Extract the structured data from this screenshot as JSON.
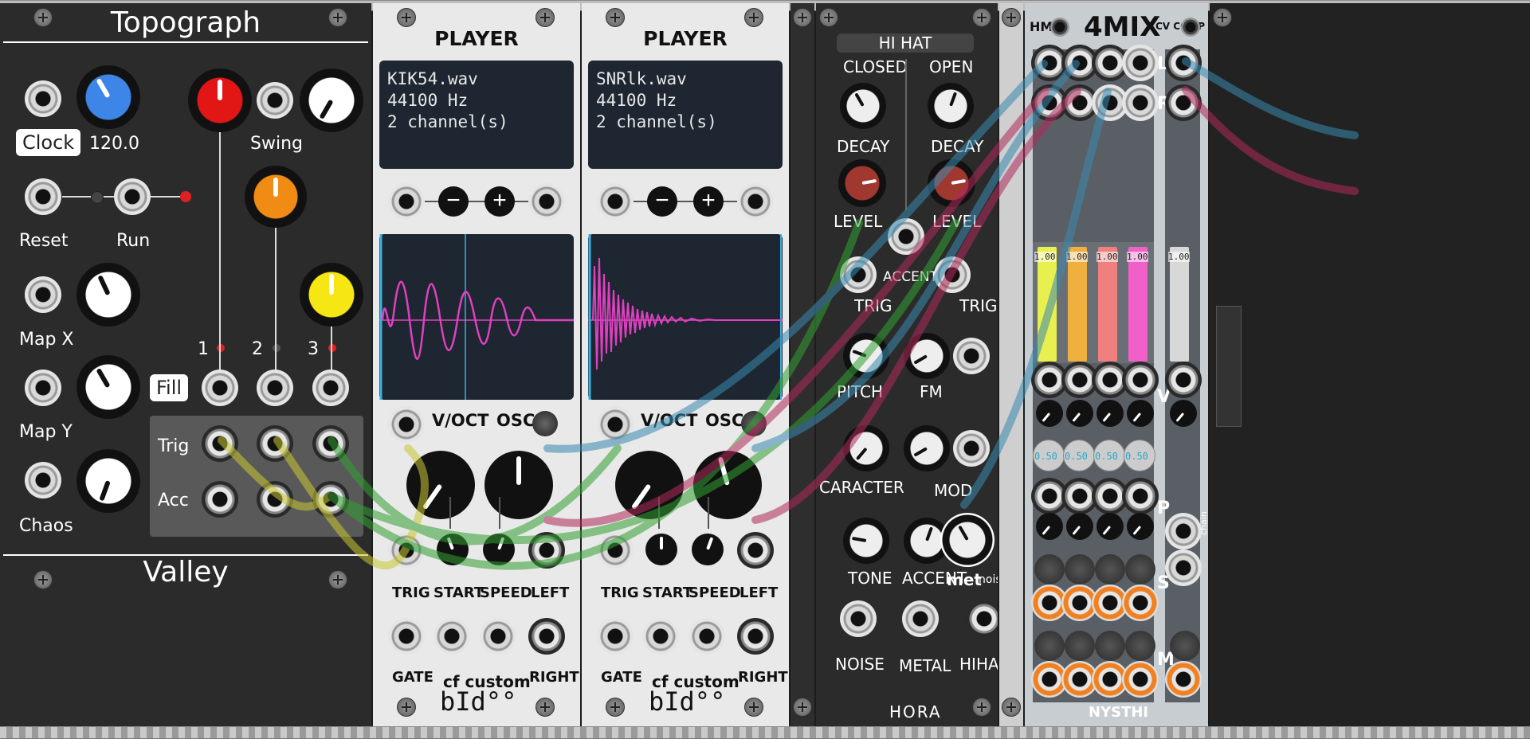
{
  "colors": {
    "rack_bg": "#1c1c1c",
    "topograph_panel": "#2b2b2b",
    "player_panel": "#e9e9e9",
    "hihat_panel": "#2b2b2b",
    "fourmix_panel": "#c8cdd2",
    "cable_yellow": "#c8c832",
    "cable_green": "#32a032",
    "cable_blue": "#3a8ab0",
    "cable_red": "#b02a5a"
  },
  "topograph": {
    "title": "Topograph",
    "footer": "Valley",
    "clock_label": "Clock",
    "tempo_value": "120.0",
    "swing_label": "Swing",
    "reset_label": "Reset",
    "run_label": "Run",
    "mapx_label": "Map X",
    "mapy_label": "Map Y",
    "chaos_label": "Chaos",
    "channel_1": "1",
    "channel_2": "2",
    "channel_3": "3",
    "fill_label": "Fill",
    "trig_label": "Trig",
    "acc_label": "Acc"
  },
  "player1": {
    "title": "PLAYER",
    "file": "KIK54.wav",
    "rate": "44100 Hz",
    "channels": "2 channel(s)",
    "minus": "−",
    "plus": "+",
    "voct": "V/OCT",
    "osc": "OSC.",
    "trig": "TRIG",
    "start": "START",
    "speed": "SPEED",
    "left": "LEFT",
    "gate": "GATE",
    "right": "RIGHT",
    "brand": "cf custom",
    "logo": "bId°°"
  },
  "player2": {
    "title": "PLAYER",
    "file": "SNRlk.wav",
    "rate": "44100 Hz",
    "channels": "2 channel(s)",
    "minus": "−",
    "plus": "+",
    "voct": "V/OCT",
    "osc": "OSC.",
    "trig": "TRIG",
    "start": "START",
    "speed": "SPEED",
    "left": "LEFT",
    "gate": "GATE",
    "right": "RIGHT",
    "brand": "cf custom",
    "logo": "bId°°"
  },
  "hihat": {
    "title": "HI HAT",
    "closed": "CLOSED",
    "open": "OPEN",
    "decay_closed": "DECAY",
    "decay_open": "DECAY",
    "level_closed": "LEVEL",
    "level_open": "LEVEL",
    "accent_top": "ACCENT",
    "trig_closed": "TRIG",
    "trig_open": "TRIG",
    "pitch": "PITCH",
    "fm": "FM",
    "caracter": "CARACTER",
    "mod": "MOD",
    "tone": "TONE",
    "accent": "ACCENT",
    "met": "met",
    "noisy": "noisy",
    "noise": "NOISE",
    "metal": "METAL",
    "hihat": "HIHAT",
    "brand": "HORA"
  },
  "fourmix": {
    "title": "4MIX",
    "hm": "HM",
    "cvcomp": "CV COMP",
    "l": "L",
    "r": "R",
    "v": "V",
    "p": "P",
    "s": "S",
    "m": "M",
    "chain": "chain",
    "brand": "NYSTHI",
    "meter_values": [
      "1.00",
      "1.00",
      "1.00",
      "1.00",
      "1.00"
    ],
    "pan_values": [
      "0.50",
      "0.50",
      "0.50",
      "0.50"
    ],
    "meter_colors": [
      "#e8f050",
      "#f0b040",
      "#f08080",
      "#f060c8"
    ]
  }
}
